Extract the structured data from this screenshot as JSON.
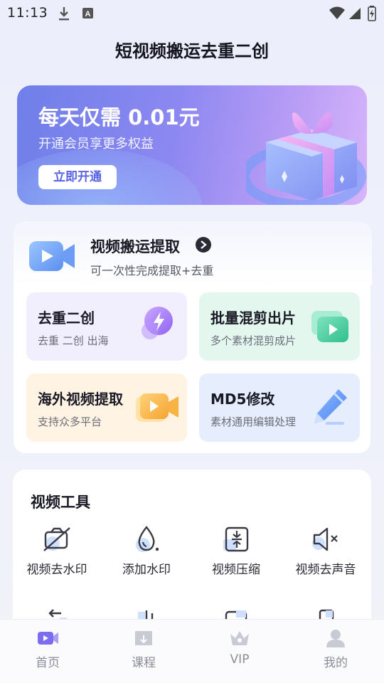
{
  "status_bar": {
    "time": "11:13",
    "icons": [
      "download-icon",
      "a-keyboard-icon",
      "wifi-icon",
      "signal-icon",
      "battery-charging-icon"
    ]
  },
  "app_title": "短视频搬运去重二创",
  "banner": {
    "title": "每天仅需 0.01元",
    "subtitle": "开通会员享更多权益",
    "button_label": "立即开通",
    "icon": "gift-box-icon"
  },
  "extract": {
    "title": "视频搬运提取",
    "subtitle": "可一次性完成提取+去重",
    "icon": "video-camera-icon"
  },
  "features": [
    {
      "title": "去重二创",
      "subtitle": "去重  二创  出海",
      "icon": "lightning-icon"
    },
    {
      "title": "批量混剪出片",
      "subtitle": "多个素材混剪成片",
      "icon": "play-icon"
    },
    {
      "title": "海外视频提取",
      "subtitle": "支持众多平台",
      "icon": "video-camera-icon"
    },
    {
      "title": "MD5修改",
      "subtitle": "素材通用编辑处理",
      "icon": "pencil-icon"
    }
  ],
  "tools": {
    "title": "视频工具",
    "items": [
      {
        "label": "视频去水印",
        "icon": "camera-off-icon"
      },
      {
        "label": "添加水印",
        "icon": "water-drop-icon"
      },
      {
        "label": "视频压缩",
        "icon": "compress-icon"
      },
      {
        "label": "视频去声音",
        "icon": "mute-icon"
      }
    ]
  },
  "nav": [
    {
      "label": "首页",
      "icon": "home-video-icon",
      "active": true
    },
    {
      "label": "课程",
      "icon": "book-icon",
      "active": false
    },
    {
      "label": "VIP",
      "icon": "crown-icon",
      "active": false
    },
    {
      "label": "我的",
      "icon": "user-icon",
      "active": false
    }
  ],
  "colors": {
    "accent": "#6f7fe9",
    "banner_end": "#d7b4fb",
    "nav_active": "#7b6cf0"
  }
}
